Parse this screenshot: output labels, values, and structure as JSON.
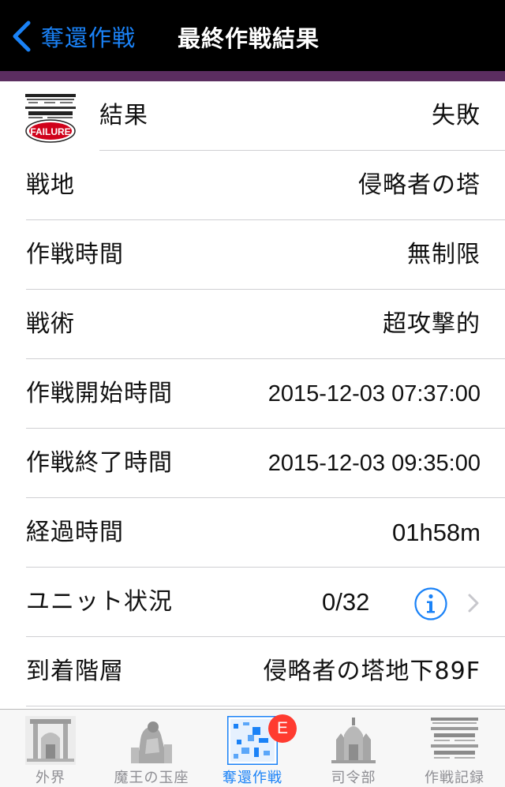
{
  "nav": {
    "back_label": "奪還作戦",
    "title": "最終作戦結果"
  },
  "colors": {
    "nav_bg": "#000000",
    "accent_bar": "#5b2d60",
    "ios_blue": "#1a82f7",
    "badge_red": "#ff3b30"
  },
  "result_icon": {
    "text": "FAILURE"
  },
  "rows": [
    {
      "label": "結果",
      "value": "失敗"
    },
    {
      "label": "戦地",
      "value": "侵略者の塔"
    },
    {
      "label": "作戦時間",
      "value": "無制限"
    },
    {
      "label": "戦術",
      "value": "超攻撃的"
    },
    {
      "label": "作戦開始時間",
      "value": "2015-12-03 07:37:00"
    },
    {
      "label": "作戦終了時間",
      "value": "2015-12-03 09:35:00"
    },
    {
      "label": "経過時間",
      "value": "01h58m"
    },
    {
      "label": "ユニット状況",
      "value": "0/32"
    },
    {
      "label": "到着階層",
      "value": "侵略者の塔地下89F"
    }
  ],
  "tabs": [
    {
      "label": "外界",
      "icon": "outer-world-icon"
    },
    {
      "label": "魔王の玉座",
      "icon": "throne-icon"
    },
    {
      "label": "奪還作戦",
      "icon": "recapture-map-icon",
      "badge": "E",
      "active": true
    },
    {
      "label": "司令部",
      "icon": "headquarters-icon"
    },
    {
      "label": "作戦記録",
      "icon": "records-icon"
    }
  ]
}
